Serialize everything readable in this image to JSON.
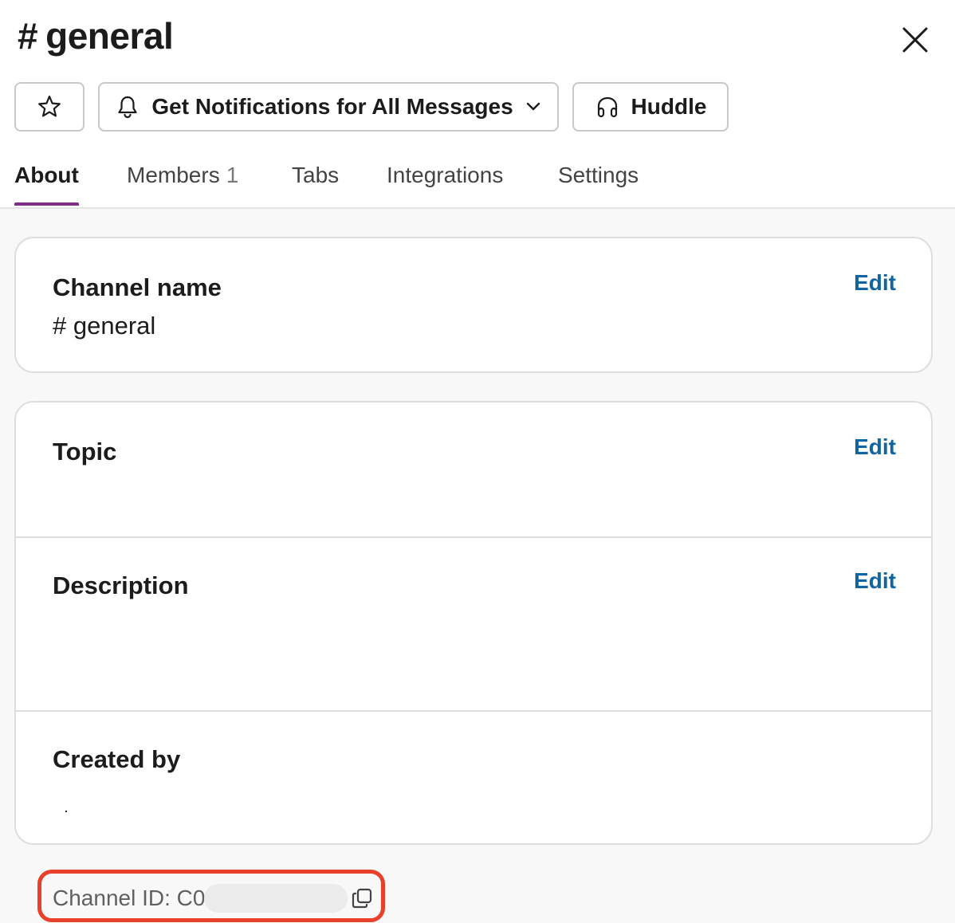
{
  "header": {
    "hash": "#",
    "title": "general",
    "close_icon": "close-icon"
  },
  "actions": {
    "star_icon": "star-icon",
    "notifications_label": "Get Notifications for All Messages",
    "bell_icon": "bell-icon",
    "chevron_icon": "chevron-down-icon",
    "huddle_label": "Huddle",
    "headphones_icon": "headphones-icon"
  },
  "tabs": [
    {
      "label": "About",
      "count": "",
      "active": true
    },
    {
      "label": "Members",
      "count": "1",
      "active": false
    },
    {
      "label": "Tabs",
      "count": "",
      "active": false
    },
    {
      "label": "Integrations",
      "count": "",
      "active": false
    },
    {
      "label": "Settings",
      "count": "",
      "active": false
    }
  ],
  "about": {
    "channel_name_label": "Channel name",
    "channel_name_value": "# general",
    "topic_label": "Topic",
    "description_label": "Description",
    "created_by_label": "Created by",
    "edit_label": "Edit"
  },
  "footer": {
    "channel_id_text": "Channel ID: C0",
    "copy_icon": "copy-icon"
  },
  "colors": {
    "accent_tab": "#7c3085",
    "link": "#1264a3",
    "highlight_border": "#e8402a"
  }
}
